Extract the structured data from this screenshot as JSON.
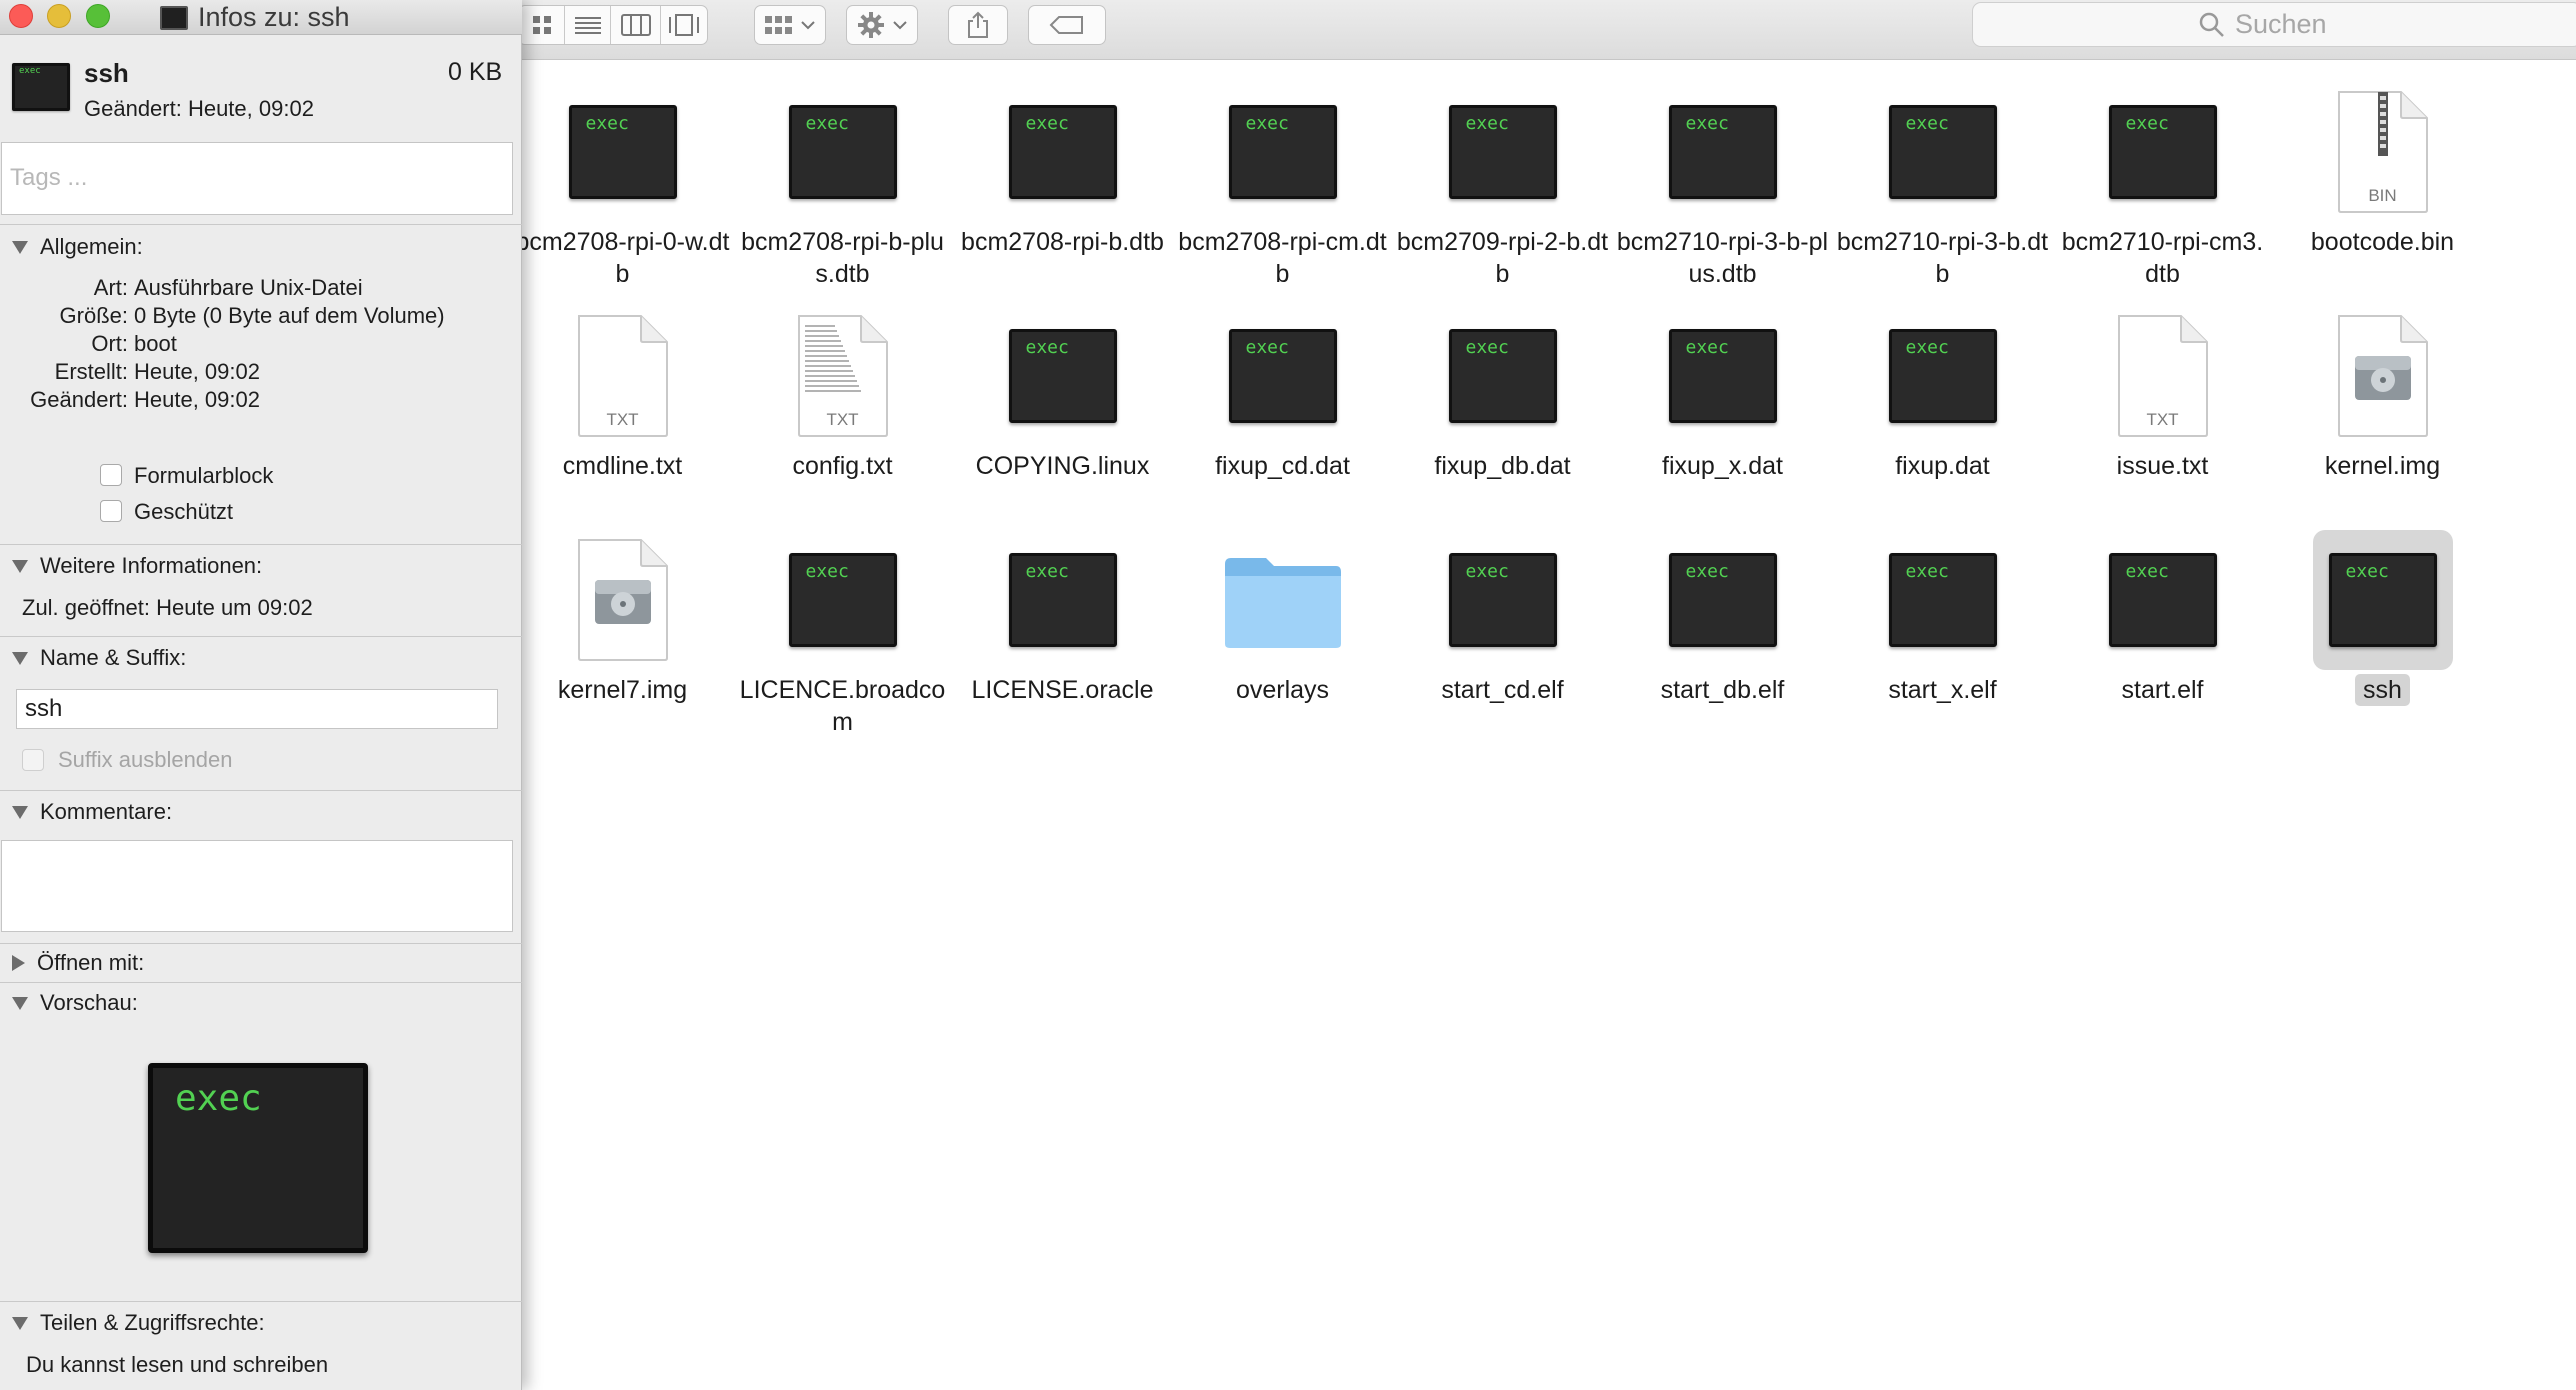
{
  "info_window": {
    "title": "Infos zu: ssh",
    "file_name": "ssh",
    "file_size": "0 KB",
    "modified_summary": "Geändert: Heute, 09:02",
    "tags_placeholder": "Tags ...",
    "general": {
      "heading": "Allgemein:",
      "rows": [
        {
          "label": "Art:",
          "value": "Ausführbare Unix-Datei"
        },
        {
          "label": "Größe:",
          "value": "0 Byte (0 Byte auf dem Volume)"
        },
        {
          "label": "Ort:",
          "value": "boot"
        },
        {
          "label": "Erstellt:",
          "value": "Heute, 09:02"
        },
        {
          "label": "Geändert:",
          "value": "Heute, 09:02"
        }
      ],
      "checkbox_stationery": "Formularblock",
      "checkbox_locked": "Geschützt"
    },
    "more_info": {
      "heading": "Weitere Informationen:",
      "last_opened": "Zul. geöffnet: Heute um 09:02"
    },
    "name_extension": {
      "heading": "Name & Suffix:",
      "name_value": "ssh",
      "hide_extension_label": "Suffix ausblenden"
    },
    "comments": {
      "heading": "Kommentare:",
      "value": ""
    },
    "open_with": {
      "heading": "Öffnen mit:"
    },
    "preview": {
      "heading": "Vorschau:",
      "icon_label": "exec"
    },
    "sharing": {
      "heading": "Teilen & Zugriffsrechte:",
      "summary": "Du kannst lesen und schreiben"
    }
  },
  "finder": {
    "search_placeholder": "Suchen",
    "exec_badge": "exec",
    "doc_badges": {
      "txt": "TXT",
      "bin": "BIN"
    },
    "files": [
      {
        "name": "bcm2708-rpi-0-w.dtb",
        "icon": "exec"
      },
      {
        "name": "bcm2708-rpi-b-plus.dtb",
        "icon": "exec"
      },
      {
        "name": "bcm2708-rpi-b.dtb",
        "icon": "exec"
      },
      {
        "name": "bcm2708-rpi-cm.dtb",
        "icon": "exec"
      },
      {
        "name": "bcm2709-rpi-2-b.dtb",
        "icon": "exec"
      },
      {
        "name": "bcm2710-rpi-3-b-plus.dtb",
        "icon": "exec"
      },
      {
        "name": "bcm2710-rpi-3-b.dtb",
        "icon": "exec"
      },
      {
        "name": "bcm2710-rpi-cm3.dtb",
        "icon": "exec"
      },
      {
        "name": "bootcode.bin",
        "icon": "bin"
      },
      {
        "name": "cmdline.txt",
        "icon": "txt"
      },
      {
        "name": "config.txt",
        "icon": "txt-lines"
      },
      {
        "name": "COPYING.linux",
        "icon": "exec"
      },
      {
        "name": "fixup_cd.dat",
        "icon": "exec"
      },
      {
        "name": "fixup_db.dat",
        "icon": "exec"
      },
      {
        "name": "fixup_x.dat",
        "icon": "exec"
      },
      {
        "name": "fixup.dat",
        "icon": "exec"
      },
      {
        "name": "issue.txt",
        "icon": "txt"
      },
      {
        "name": "kernel.img",
        "icon": "disk"
      },
      {
        "name": "kernel7.img",
        "icon": "disk"
      },
      {
        "name": "LICENCE.broadcom",
        "icon": "exec"
      },
      {
        "name": "LICENSE.oracle",
        "icon": "exec"
      },
      {
        "name": "overlays",
        "icon": "folder"
      },
      {
        "name": "start_cd.elf",
        "icon": "exec"
      },
      {
        "name": "start_db.elf",
        "icon": "exec"
      },
      {
        "name": "start_x.elf",
        "icon": "exec"
      },
      {
        "name": "start.elf",
        "icon": "exec"
      },
      {
        "name": "ssh",
        "icon": "exec",
        "selected": true
      }
    ]
  }
}
